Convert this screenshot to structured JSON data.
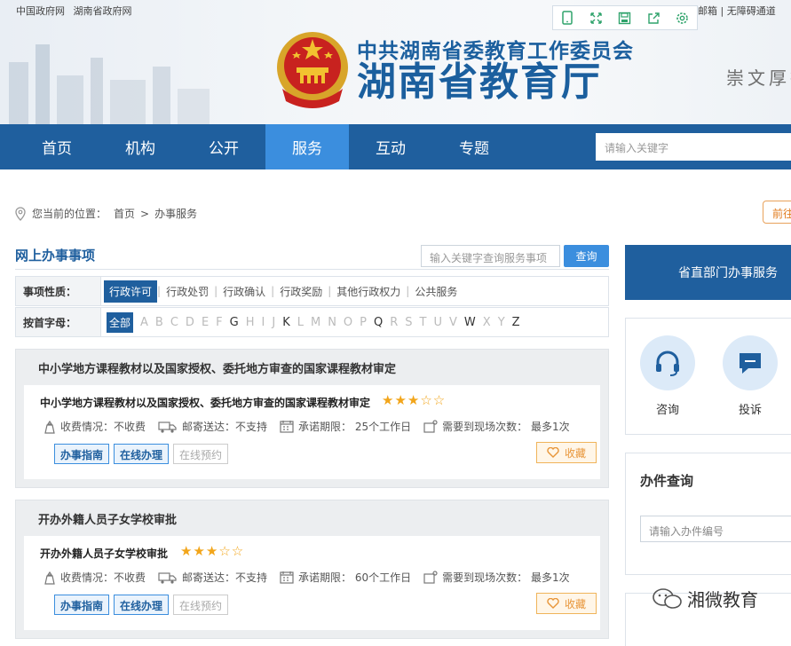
{
  "header": {
    "top_links": [
      "中国政府网",
      "湖南省政府网"
    ],
    "top_right": "邮箱 | 无障碍通道",
    "toolbar_icons": [
      "mobile-icon",
      "fullscreen-icon",
      "save-icon",
      "share-icon",
      "settings-icon"
    ],
    "org_sub": "中共湖南省委教育工作委员会",
    "org_main": "湖南省教育厅",
    "motto": "崇文厚德"
  },
  "nav": {
    "items": [
      {
        "label": "首页"
      },
      {
        "label": "机构"
      },
      {
        "label": "公开"
      },
      {
        "label": "服务",
        "active": true
      },
      {
        "label": "互动"
      },
      {
        "label": "专题"
      }
    ],
    "search_placeholder": "请输入关键字"
  },
  "breadcrumb": {
    "prefix": "您当前的位置：",
    "items": [
      "首页",
      "办事服务"
    ],
    "separator": ">"
  },
  "goto_button": "前往",
  "services": {
    "title": "网上办事事项",
    "search_placeholder": "输入关键字查询服务事项",
    "search_button": "查询",
    "filter_type": {
      "label": "事项性质：",
      "options": [
        "行政许可",
        "行政处罚",
        "行政确认",
        "行政奖励",
        "其他行政权力",
        "公共服务"
      ],
      "selected": "行政许可"
    },
    "filter_letter": {
      "label": "按首字母：",
      "all": "全部",
      "letters": [
        "A",
        "B",
        "C",
        "D",
        "E",
        "F",
        "G",
        "H",
        "I",
        "J",
        "K",
        "L",
        "M",
        "N",
        "O",
        "P",
        "Q",
        "R",
        "S",
        "T",
        "U",
        "V",
        "W",
        "X",
        "Y",
        "Z"
      ],
      "enabled": [
        "G",
        "K",
        "Q",
        "W",
        "Z"
      ]
    },
    "items": [
      {
        "group_title": "中小学地方课程教材以及国家授权、委托地方审查的国家课程教材审定",
        "title": "中小学地方课程教材以及国家授权、委托地方审查的国家课程教材审定",
        "rating": 3,
        "rating_max": 5,
        "fee": "收费情况：不收费",
        "delivery": "邮寄送达：不支持",
        "deadline": "承诺期限： 25个工作日",
        "visits": "需要到现场次数： 最多1次",
        "btn_guide": "办事指南",
        "btn_online": "在线办理",
        "btn_booking": "在线预约",
        "btn_fav": "收藏"
      },
      {
        "group_title": "开办外籍人员子女学校审批",
        "title": "开办外籍人员子女学校审批",
        "rating": 3,
        "rating_max": 5,
        "fee": "收费情况：不收费",
        "delivery": "邮寄送达：不支持",
        "deadline": "承诺期限： 60个工作日",
        "visits": "需要到现场次数： 最多1次",
        "btn_guide": "办事指南",
        "btn_online": "在线办理",
        "btn_booking": "在线预约",
        "btn_fav": "收藏"
      }
    ]
  },
  "right_panel": {
    "dept_services": "省直部门办事服务",
    "consult_label": "咨询",
    "complaint_label": "投诉",
    "query_title": "办件查询",
    "query_placeholder": "请输入办件编号"
  },
  "watermark": "湘微教育",
  "colors": {
    "primary": "#1f5f9e",
    "accent": "#3b8ede",
    "star": "#f2a51a",
    "fav": "#e8963a"
  }
}
